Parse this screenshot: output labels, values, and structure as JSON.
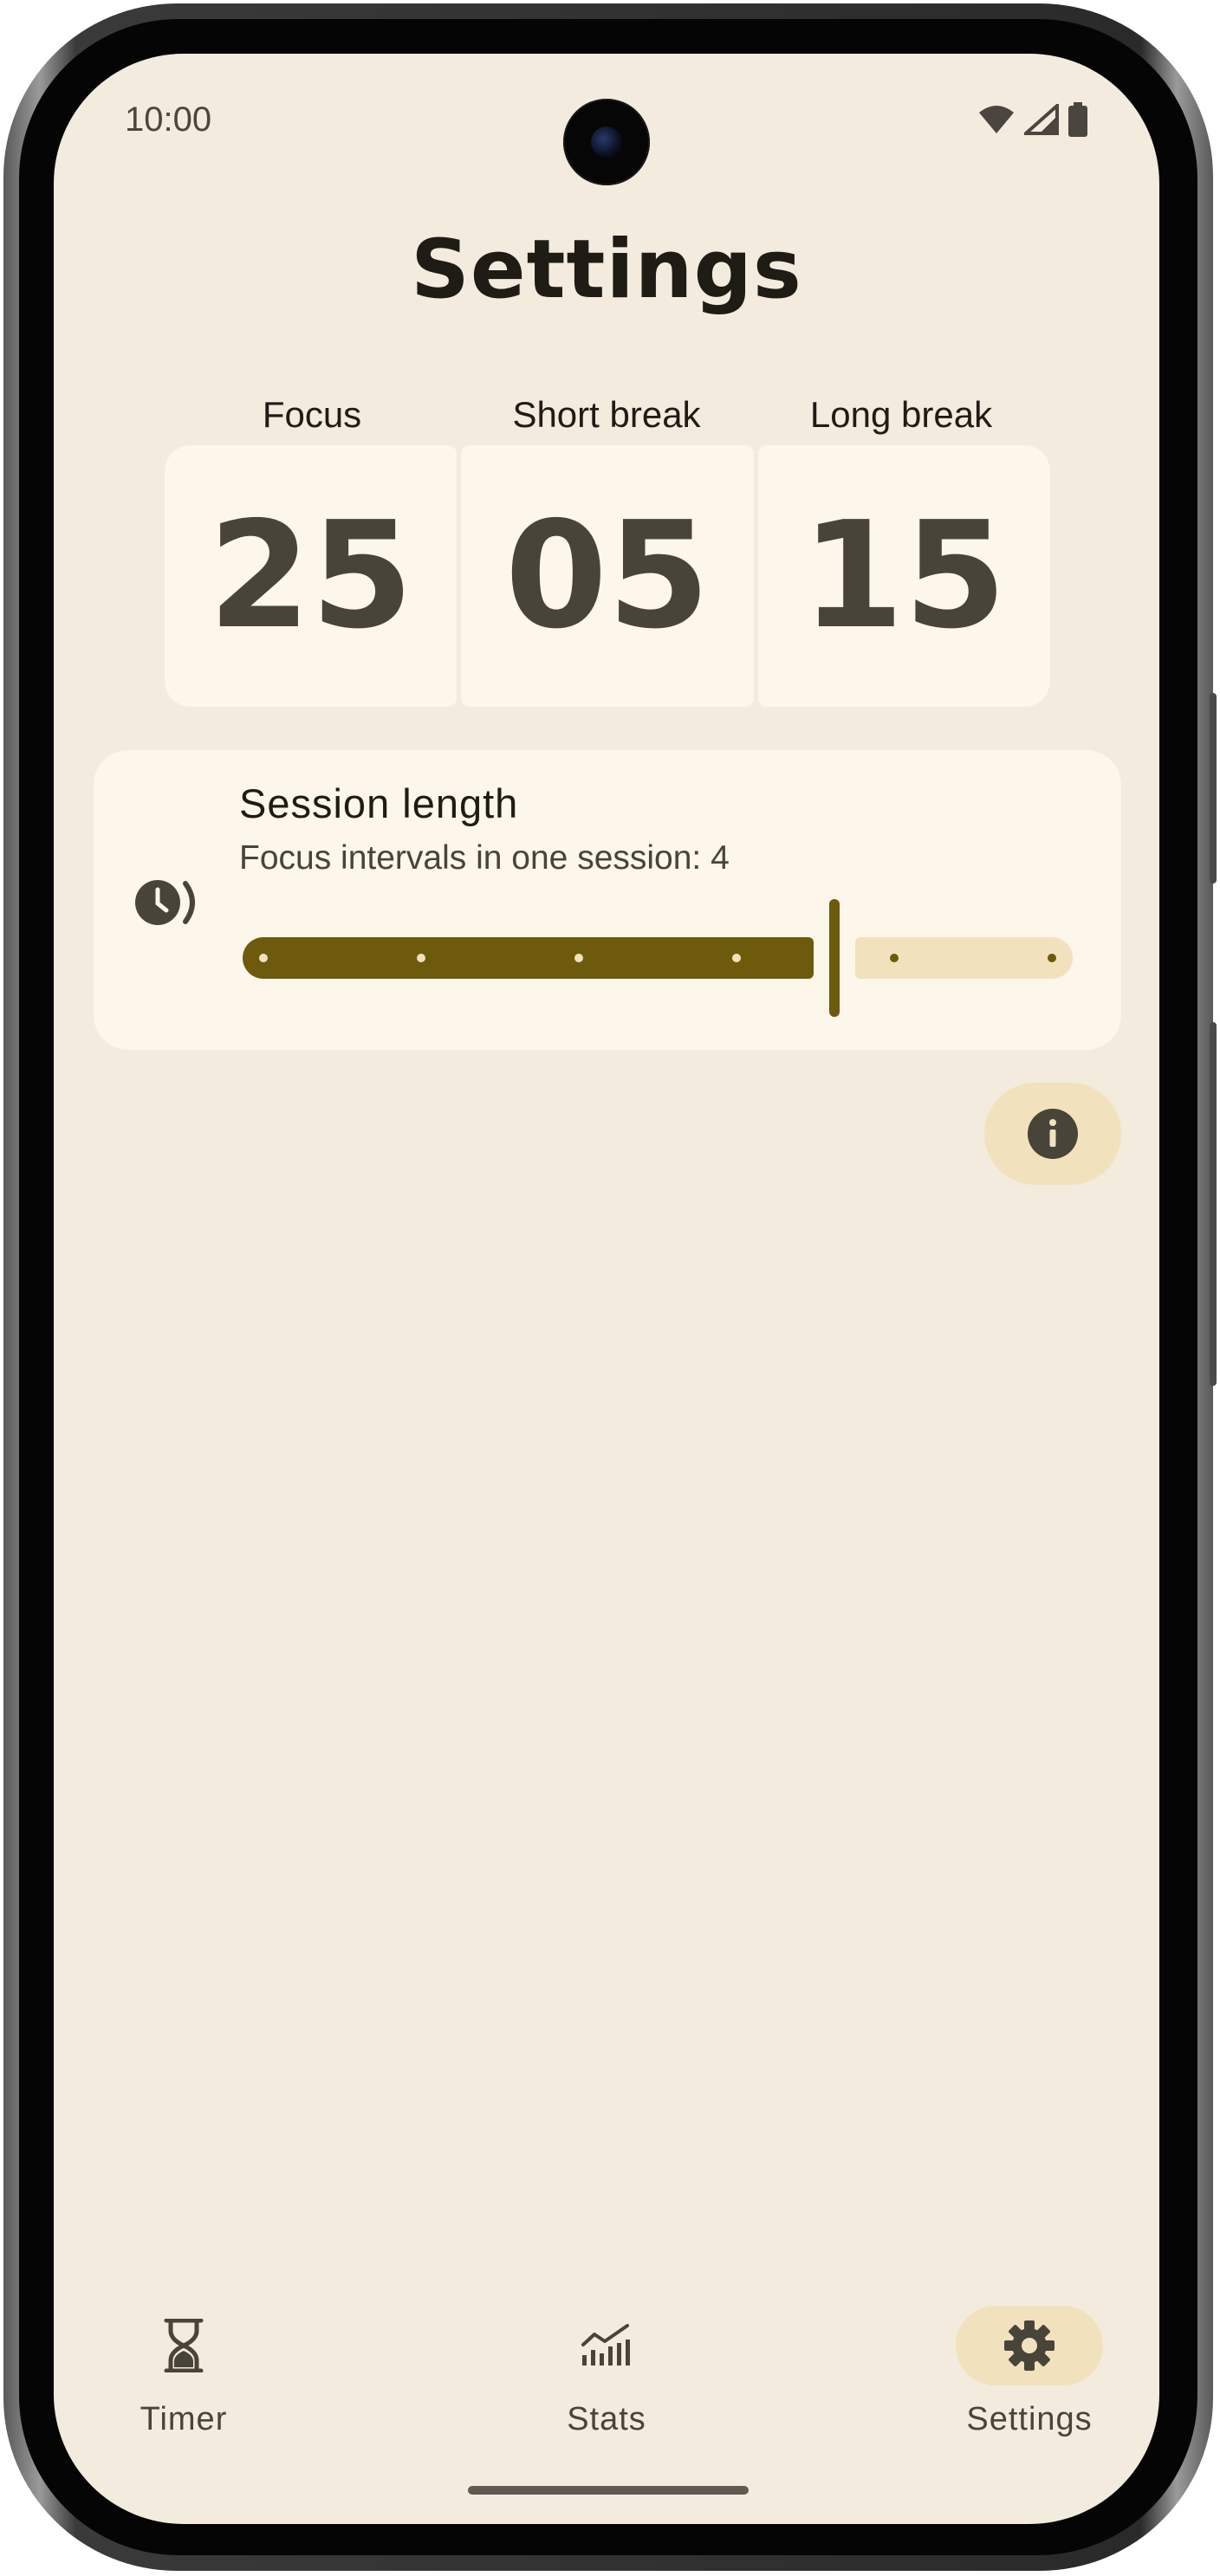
{
  "status_bar": {
    "time": "10:00"
  },
  "page": {
    "title": "Settings"
  },
  "timers": {
    "labels": [
      "Focus",
      "Short break",
      "Long break"
    ],
    "values": [
      "25",
      "05",
      "15"
    ]
  },
  "session_card": {
    "title": "Session length",
    "subtitle": "Focus intervals in one session: 4",
    "slider": {
      "value": 4,
      "min": 1,
      "max": 6
    }
  },
  "bottom_nav": {
    "items": [
      {
        "label": "Timer",
        "icon": "hourglass-icon"
      },
      {
        "label": "Stats",
        "icon": "stats-chart-icon"
      },
      {
        "label": "Settings",
        "icon": "gear-icon",
        "active": true
      }
    ]
  },
  "colors": {
    "background": "#f3ebdd",
    "surface": "#fdf6ea",
    "accent": "#6d5a0d",
    "accent_container": "#f1e2bd",
    "on_surface": "#1f1c16"
  }
}
